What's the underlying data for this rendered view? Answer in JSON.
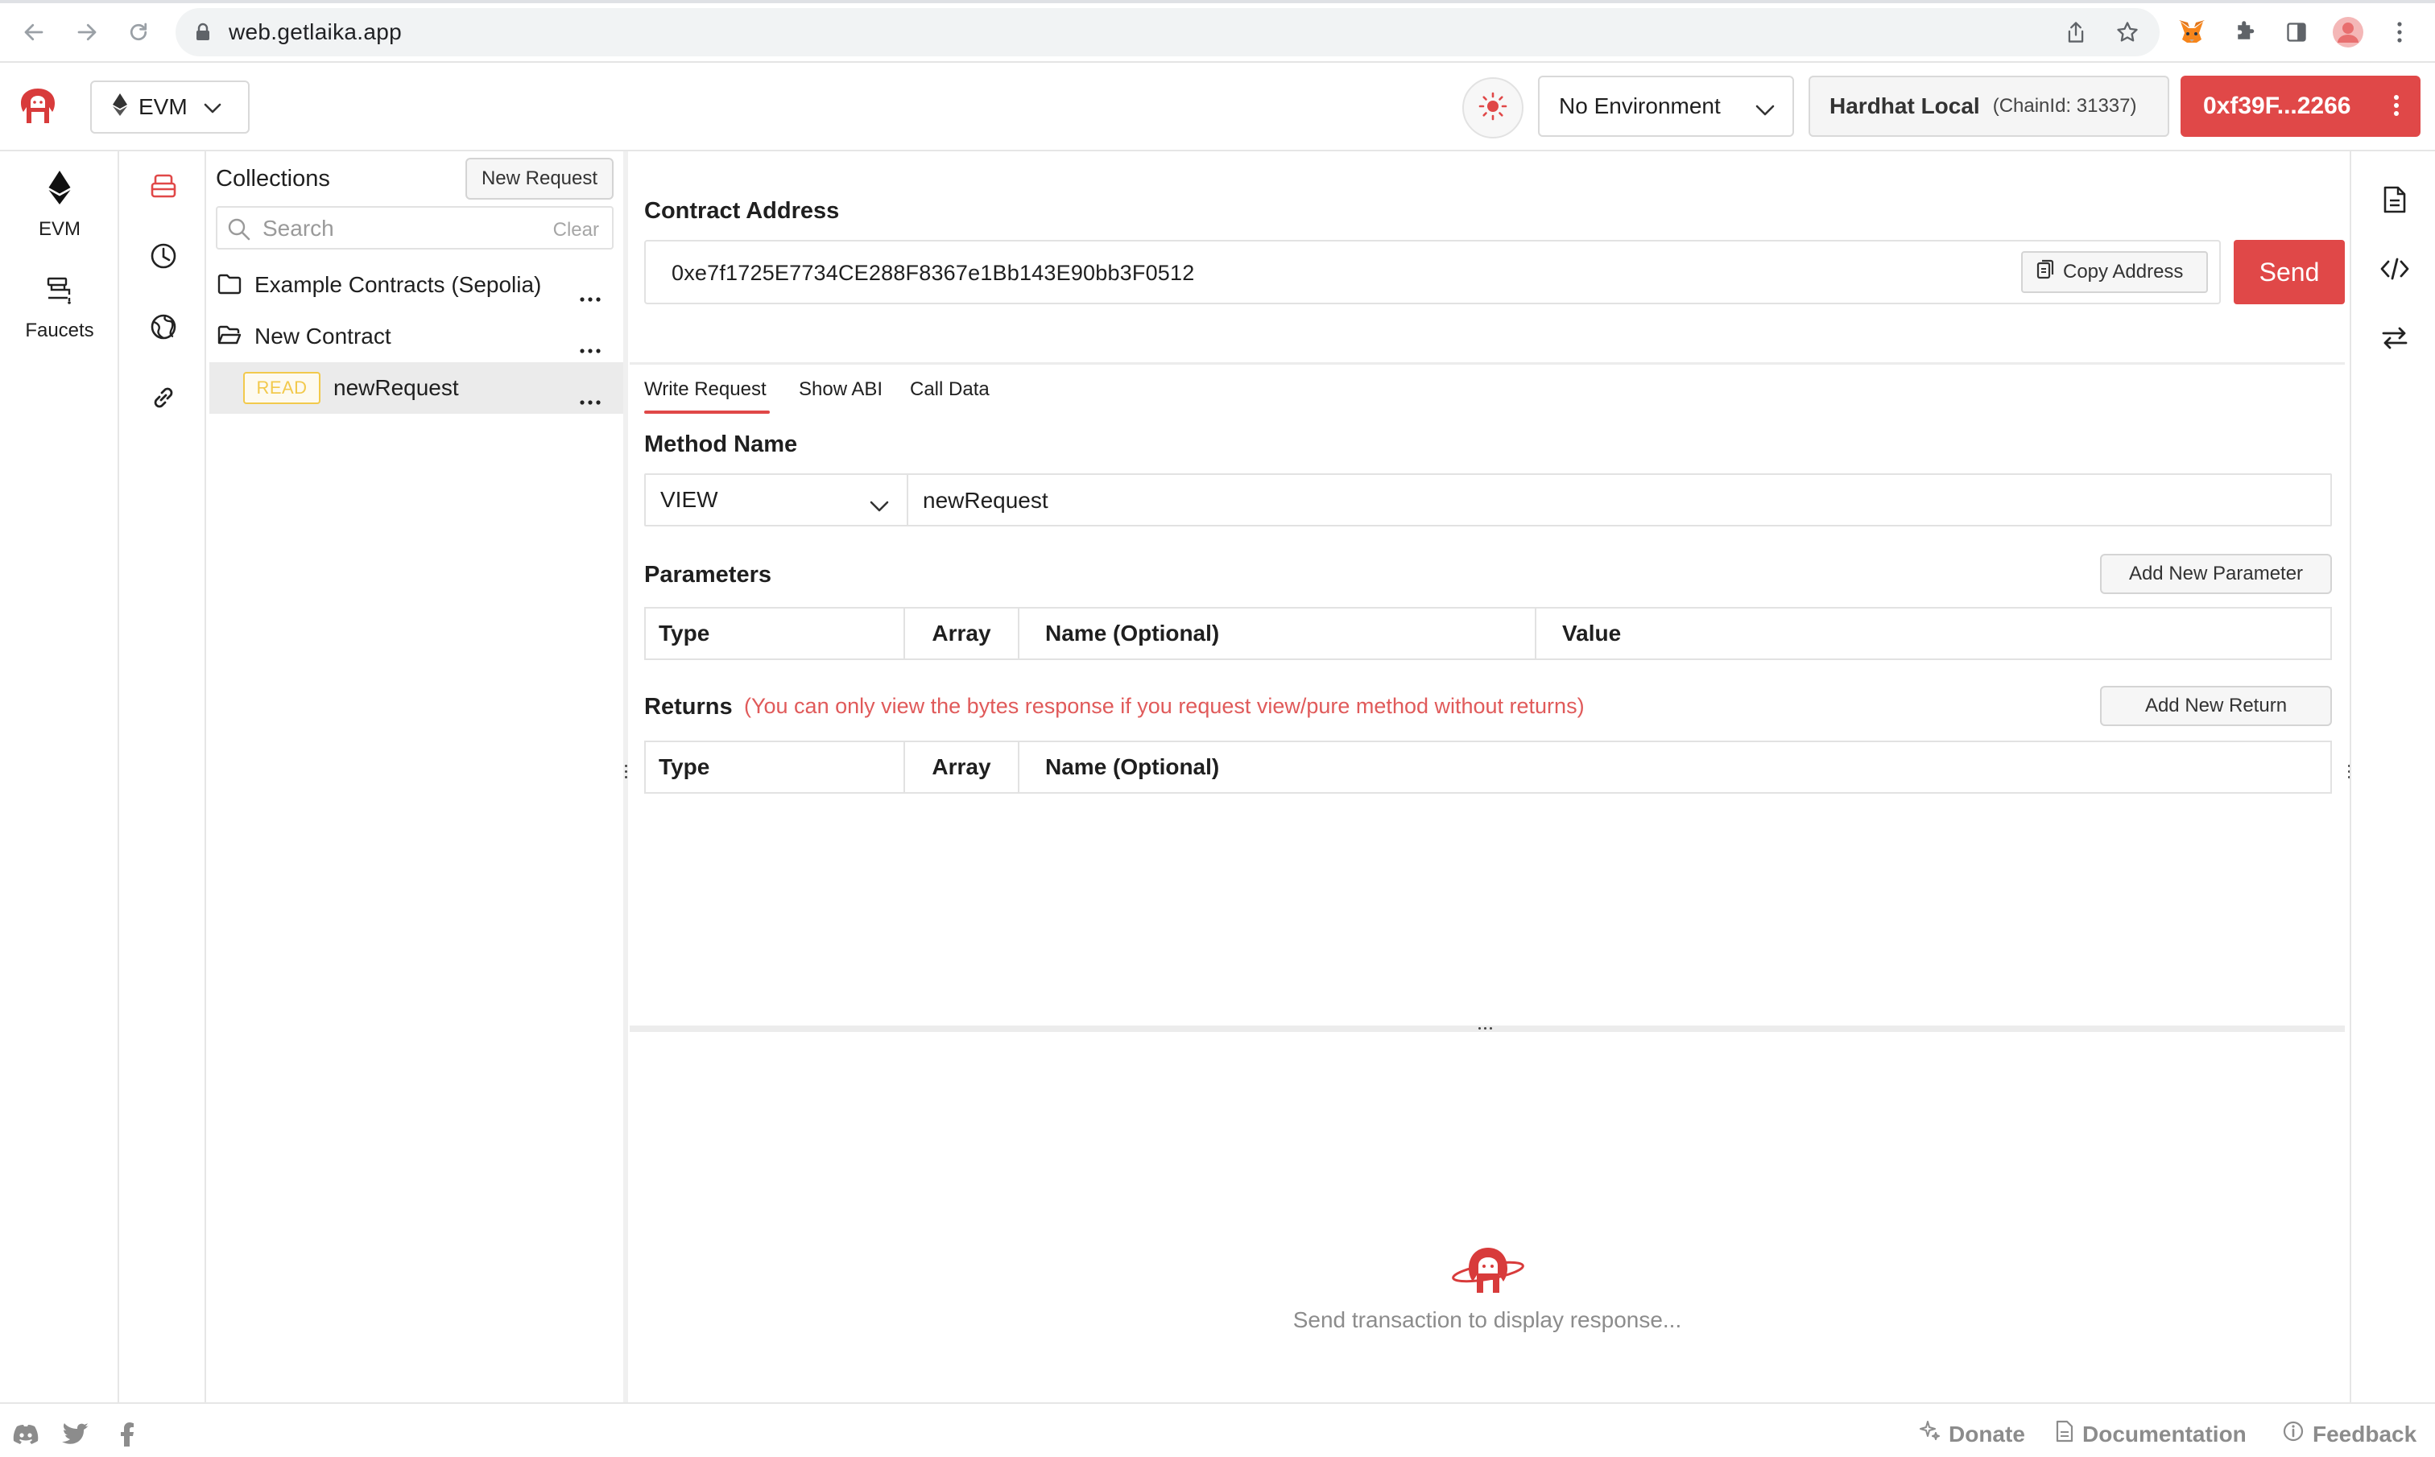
{
  "browser": {
    "url": "web.getlaika.app"
  },
  "header": {
    "chain_label": "EVM",
    "environment_label": "No Environment",
    "network_name": "Hardhat Local",
    "network_chain": "(ChainId: 31337)",
    "account_label": "0xf39F...2266",
    "accent_color": "#e04848"
  },
  "rail": {
    "items": [
      {
        "label": "EVM",
        "icon": "ethereum-icon"
      },
      {
        "label": "Faucets",
        "icon": "faucet-icon"
      }
    ]
  },
  "subrail": {
    "icons": [
      "collections-icon",
      "history-icon",
      "globe-icon",
      "link-icon"
    ]
  },
  "collections": {
    "title": "Collections",
    "new_request_label": "New Request",
    "search_placeholder": "Search",
    "clear_label": "Clear",
    "items": [
      {
        "label": "Example Contracts (Sepolia)",
        "type": "folder"
      },
      {
        "label": "New Contract",
        "type": "folder-open"
      },
      {
        "label": "newRequest",
        "type": "request",
        "badge": "READ"
      }
    ]
  },
  "main": {
    "contract_address_label": "Contract Address",
    "contract_address": "0xe7f1725E7734CE288F8367e1Bb143E90bb3F0512",
    "copy_address_label": "Copy Address",
    "send_label": "Send",
    "tabs": [
      {
        "label": "Write Request",
        "active": true
      },
      {
        "label": "Show ABI",
        "active": false
      },
      {
        "label": "Call Data",
        "active": false
      }
    ],
    "method_name_label": "Method Name",
    "method_type": "VIEW",
    "method_name": "newRequest",
    "parameters_label": "Parameters",
    "add_parameter_label": "Add New Parameter",
    "parameters_columns": [
      "Type",
      "Array",
      "Name (Optional)",
      "Value"
    ],
    "returns_label": "Returns",
    "returns_note": "(You can only view the bytes response if you request view/pure method without returns)",
    "add_return_label": "Add New Return",
    "returns_columns": [
      "Type",
      "Array",
      "Name (Optional)"
    ],
    "response_placeholder": "Send transaction to display response..."
  },
  "right_rail": {
    "icons": [
      "document-icon",
      "code-icon",
      "swap-icon"
    ]
  },
  "footer": {
    "social": [
      "discord-icon",
      "twitter-icon",
      "facebook-icon"
    ],
    "links": [
      {
        "label": "Donate",
        "icon": "sparkle-icon"
      },
      {
        "label": "Documentation",
        "icon": "doc-icon"
      },
      {
        "label": "Feedback",
        "icon": "info-icon"
      }
    ]
  }
}
